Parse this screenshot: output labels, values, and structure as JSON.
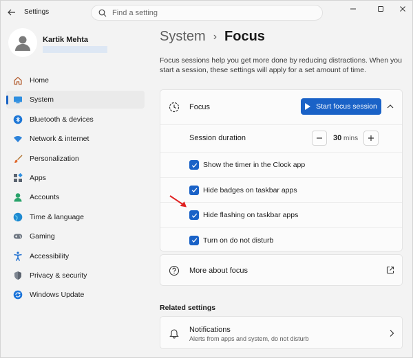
{
  "app": {
    "title": "Settings"
  },
  "search": {
    "placeholder": "Find a setting"
  },
  "user": {
    "name": "Kartik Mehta"
  },
  "nav": {
    "items": [
      {
        "label": "Home",
        "icon": "home-icon",
        "active": false
      },
      {
        "label": "System",
        "icon": "system-icon",
        "active": true
      },
      {
        "label": "Bluetooth & devices",
        "icon": "bluetooth-icon",
        "active": false
      },
      {
        "label": "Network & internet",
        "icon": "wifi-icon",
        "active": false
      },
      {
        "label": "Personalization",
        "icon": "brush-icon",
        "active": false
      },
      {
        "label": "Apps",
        "icon": "apps-icon",
        "active": false
      },
      {
        "label": "Accounts",
        "icon": "accounts-icon",
        "active": false
      },
      {
        "label": "Time & language",
        "icon": "globe-icon",
        "active": false
      },
      {
        "label": "Gaming",
        "icon": "gamepad-icon",
        "active": false
      },
      {
        "label": "Accessibility",
        "icon": "accessibility-icon",
        "active": false
      },
      {
        "label": "Privacy & security",
        "icon": "shield-icon",
        "active": false
      },
      {
        "label": "Windows Update",
        "icon": "update-icon",
        "active": false
      }
    ]
  },
  "breadcrumb": {
    "parent": "System",
    "separator": "›",
    "current": "Focus"
  },
  "description": "Focus sessions help you get more done by reducing distractions. When you start a session, these settings will apply for a set amount of time.",
  "focus": {
    "title": "Focus",
    "start_button": "Start focus session",
    "duration_label": "Session duration",
    "duration_value": "30",
    "duration_unit": "mins",
    "options": [
      {
        "label": "Show the timer in the Clock app",
        "checked": true
      },
      {
        "label": "Hide badges on taskbar apps",
        "checked": true
      },
      {
        "label": "Hide flashing on taskbar apps",
        "checked": true
      },
      {
        "label": "Turn on do not disturb",
        "checked": true
      }
    ]
  },
  "more": {
    "label": "More about focus"
  },
  "related": {
    "heading": "Related settings",
    "notifications": {
      "title": "Notifications",
      "subtitle": "Alerts from apps and system, do not disturb"
    }
  },
  "colors": {
    "accent": "#1a62c7",
    "annotation": "#e02020"
  }
}
